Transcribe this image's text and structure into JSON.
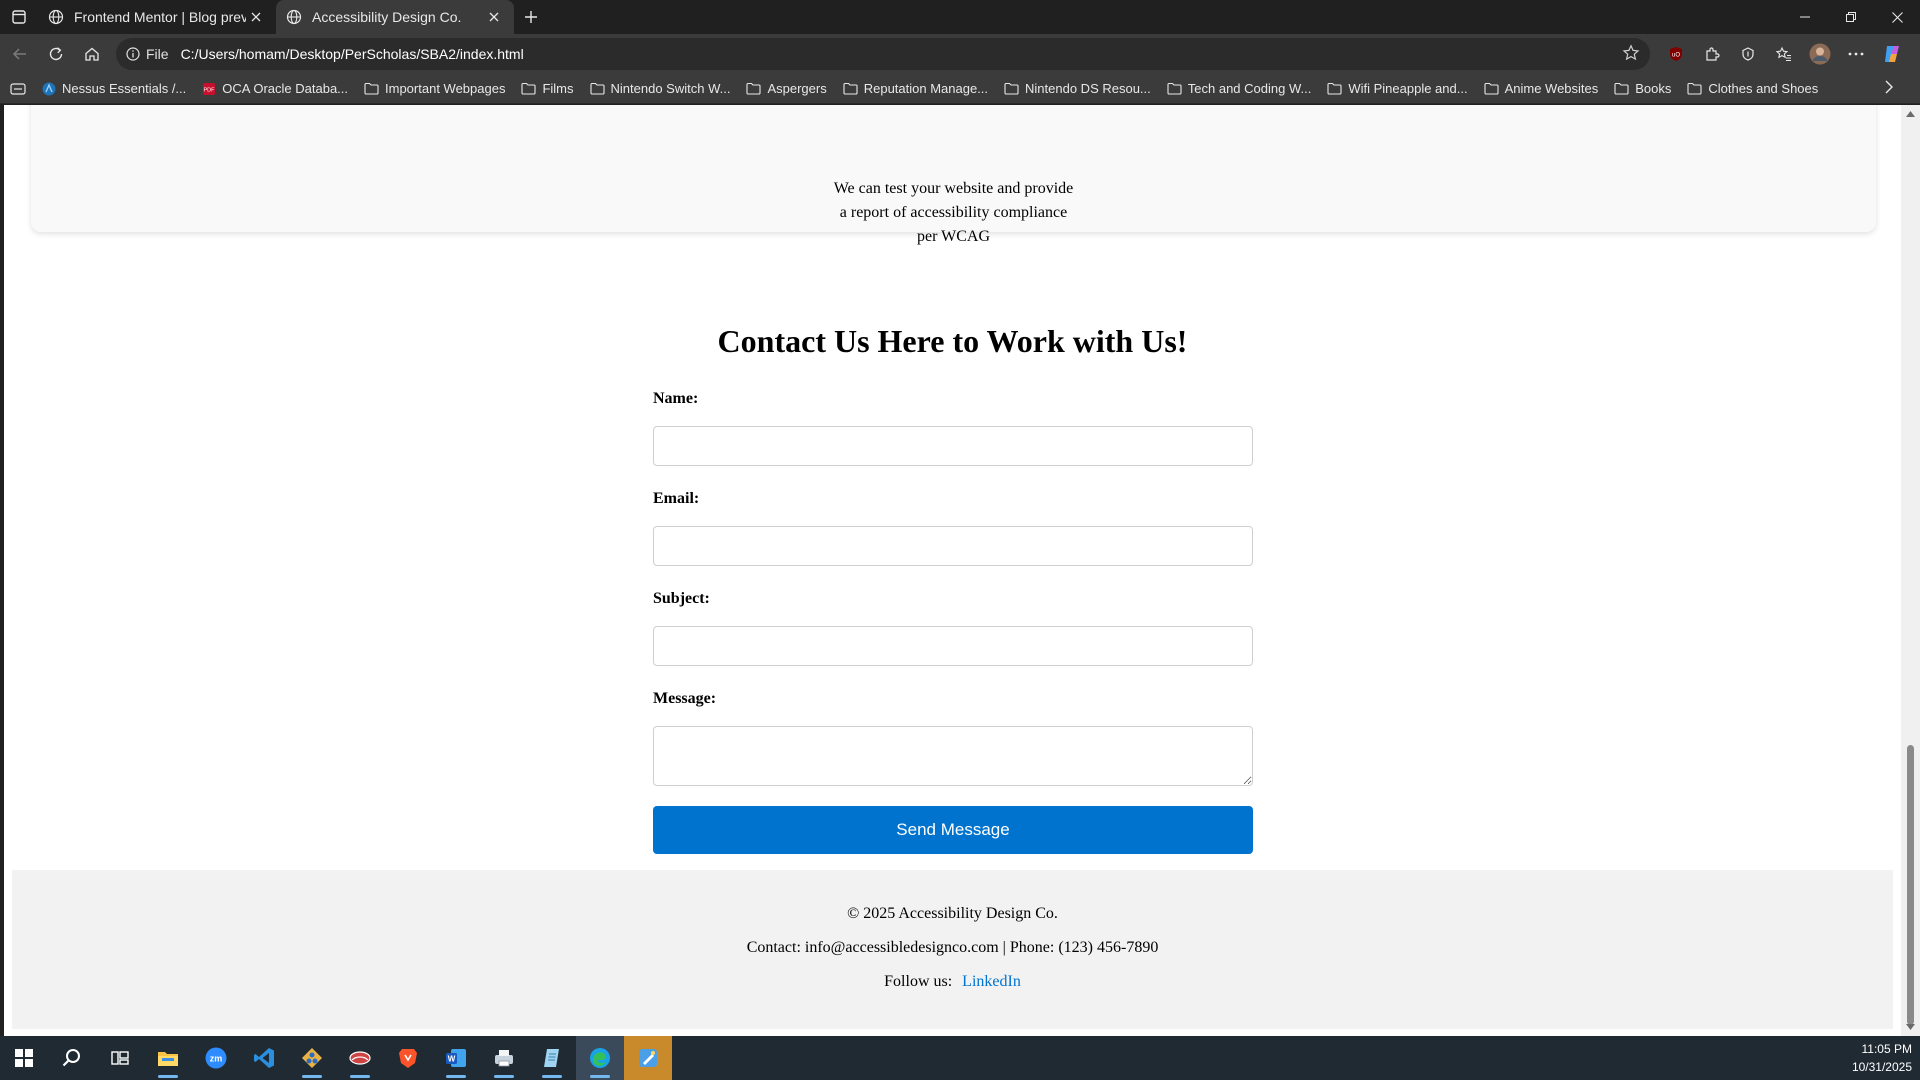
{
  "browser": {
    "tabs": [
      {
        "title": "Frontend Mentor | Blog preview c",
        "active": false
      },
      {
        "title": "Accessibility Design Co.",
        "active": true
      }
    ],
    "address": {
      "scheme_label": "File",
      "url": "C:/Users/homam/Desktop/PerScholas/SBA2/index.html"
    },
    "bookmarks": [
      {
        "label": "Nessus Essentials /...",
        "icon": "nessus-icon"
      },
      {
        "label": "OCA Oracle Databa...",
        "icon": "pdf-icon"
      },
      {
        "label": "Important Webpages",
        "icon": "folder-icon"
      },
      {
        "label": "Films",
        "icon": "folder-icon"
      },
      {
        "label": "Nintendo Switch W...",
        "icon": "folder-icon"
      },
      {
        "label": "Aspergers",
        "icon": "folder-icon"
      },
      {
        "label": "Reputation Manage...",
        "icon": "folder-icon"
      },
      {
        "label": "Nintendo DS Resou...",
        "icon": "folder-icon"
      },
      {
        "label": "Tech and Coding W...",
        "icon": "folder-icon"
      },
      {
        "label": "Wifi Pineapple and...",
        "icon": "folder-icon"
      },
      {
        "label": "Anime Websites",
        "icon": "folder-icon"
      },
      {
        "label": "Books",
        "icon": "folder-icon"
      },
      {
        "label": "Clothes and Shoes",
        "icon": "folder-icon"
      }
    ]
  },
  "page": {
    "service_text": {
      "line1": "We can test your website and provide",
      "line2": "a report of accessibility compliance",
      "line3": "per WCAG"
    },
    "contact": {
      "title": "Contact Us Here to Work with Us!",
      "name_label": "Name:",
      "email_label": "Email:",
      "subject_label": "Subject:",
      "message_label": "Message:",
      "name_value": "",
      "email_value": "",
      "subject_value": "",
      "message_value": "",
      "send_label": "Send Message"
    },
    "footer": {
      "copyright": "© 2025 Accessibility Design Co.",
      "contact_line": "Contact: info@accessibledesignco.com | Phone: (123) 456-7890",
      "follow_label": "Follow us:",
      "linkedin_label": "LinkedIn"
    }
  },
  "taskbar": {
    "time": "11:05 PM",
    "date": "10/31/2025"
  },
  "colors": {
    "accent_button": "#0073cf",
    "link": "#0073cf",
    "footer_bg": "#f2f2f2",
    "browser_chrome": "#3b3b3b"
  }
}
